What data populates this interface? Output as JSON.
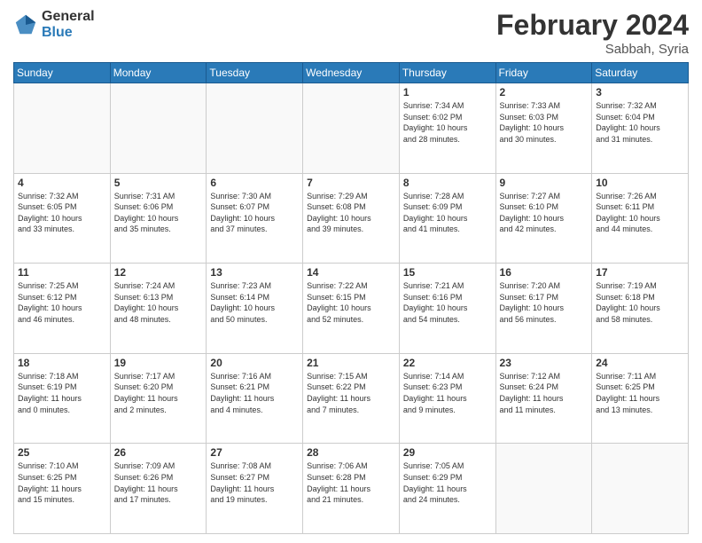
{
  "logo": {
    "general": "General",
    "blue": "Blue"
  },
  "title": {
    "month_year": "February 2024",
    "location": "Sabbah, Syria"
  },
  "headers": [
    "Sunday",
    "Monday",
    "Tuesday",
    "Wednesday",
    "Thursday",
    "Friday",
    "Saturday"
  ],
  "weeks": [
    [
      {
        "day": "",
        "info": ""
      },
      {
        "day": "",
        "info": ""
      },
      {
        "day": "",
        "info": ""
      },
      {
        "day": "",
        "info": ""
      },
      {
        "day": "1",
        "info": "Sunrise: 7:34 AM\nSunset: 6:02 PM\nDaylight: 10 hours\nand 28 minutes."
      },
      {
        "day": "2",
        "info": "Sunrise: 7:33 AM\nSunset: 6:03 PM\nDaylight: 10 hours\nand 30 minutes."
      },
      {
        "day": "3",
        "info": "Sunrise: 7:32 AM\nSunset: 6:04 PM\nDaylight: 10 hours\nand 31 minutes."
      }
    ],
    [
      {
        "day": "4",
        "info": "Sunrise: 7:32 AM\nSunset: 6:05 PM\nDaylight: 10 hours\nand 33 minutes."
      },
      {
        "day": "5",
        "info": "Sunrise: 7:31 AM\nSunset: 6:06 PM\nDaylight: 10 hours\nand 35 minutes."
      },
      {
        "day": "6",
        "info": "Sunrise: 7:30 AM\nSunset: 6:07 PM\nDaylight: 10 hours\nand 37 minutes."
      },
      {
        "day": "7",
        "info": "Sunrise: 7:29 AM\nSunset: 6:08 PM\nDaylight: 10 hours\nand 39 minutes."
      },
      {
        "day": "8",
        "info": "Sunrise: 7:28 AM\nSunset: 6:09 PM\nDaylight: 10 hours\nand 41 minutes."
      },
      {
        "day": "9",
        "info": "Sunrise: 7:27 AM\nSunset: 6:10 PM\nDaylight: 10 hours\nand 42 minutes."
      },
      {
        "day": "10",
        "info": "Sunrise: 7:26 AM\nSunset: 6:11 PM\nDaylight: 10 hours\nand 44 minutes."
      }
    ],
    [
      {
        "day": "11",
        "info": "Sunrise: 7:25 AM\nSunset: 6:12 PM\nDaylight: 10 hours\nand 46 minutes."
      },
      {
        "day": "12",
        "info": "Sunrise: 7:24 AM\nSunset: 6:13 PM\nDaylight: 10 hours\nand 48 minutes."
      },
      {
        "day": "13",
        "info": "Sunrise: 7:23 AM\nSunset: 6:14 PM\nDaylight: 10 hours\nand 50 minutes."
      },
      {
        "day": "14",
        "info": "Sunrise: 7:22 AM\nSunset: 6:15 PM\nDaylight: 10 hours\nand 52 minutes."
      },
      {
        "day": "15",
        "info": "Sunrise: 7:21 AM\nSunset: 6:16 PM\nDaylight: 10 hours\nand 54 minutes."
      },
      {
        "day": "16",
        "info": "Sunrise: 7:20 AM\nSunset: 6:17 PM\nDaylight: 10 hours\nand 56 minutes."
      },
      {
        "day": "17",
        "info": "Sunrise: 7:19 AM\nSunset: 6:18 PM\nDaylight: 10 hours\nand 58 minutes."
      }
    ],
    [
      {
        "day": "18",
        "info": "Sunrise: 7:18 AM\nSunset: 6:19 PM\nDaylight: 11 hours\nand 0 minutes."
      },
      {
        "day": "19",
        "info": "Sunrise: 7:17 AM\nSunset: 6:20 PM\nDaylight: 11 hours\nand 2 minutes."
      },
      {
        "day": "20",
        "info": "Sunrise: 7:16 AM\nSunset: 6:21 PM\nDaylight: 11 hours\nand 4 minutes."
      },
      {
        "day": "21",
        "info": "Sunrise: 7:15 AM\nSunset: 6:22 PM\nDaylight: 11 hours\nand 7 minutes."
      },
      {
        "day": "22",
        "info": "Sunrise: 7:14 AM\nSunset: 6:23 PM\nDaylight: 11 hours\nand 9 minutes."
      },
      {
        "day": "23",
        "info": "Sunrise: 7:12 AM\nSunset: 6:24 PM\nDaylight: 11 hours\nand 11 minutes."
      },
      {
        "day": "24",
        "info": "Sunrise: 7:11 AM\nSunset: 6:25 PM\nDaylight: 11 hours\nand 13 minutes."
      }
    ],
    [
      {
        "day": "25",
        "info": "Sunrise: 7:10 AM\nSunset: 6:25 PM\nDaylight: 11 hours\nand 15 minutes."
      },
      {
        "day": "26",
        "info": "Sunrise: 7:09 AM\nSunset: 6:26 PM\nDaylight: 11 hours\nand 17 minutes."
      },
      {
        "day": "27",
        "info": "Sunrise: 7:08 AM\nSunset: 6:27 PM\nDaylight: 11 hours\nand 19 minutes."
      },
      {
        "day": "28",
        "info": "Sunrise: 7:06 AM\nSunset: 6:28 PM\nDaylight: 11 hours\nand 21 minutes."
      },
      {
        "day": "29",
        "info": "Sunrise: 7:05 AM\nSunset: 6:29 PM\nDaylight: 11 hours\nand 24 minutes."
      },
      {
        "day": "",
        "info": ""
      },
      {
        "day": "",
        "info": ""
      }
    ]
  ]
}
